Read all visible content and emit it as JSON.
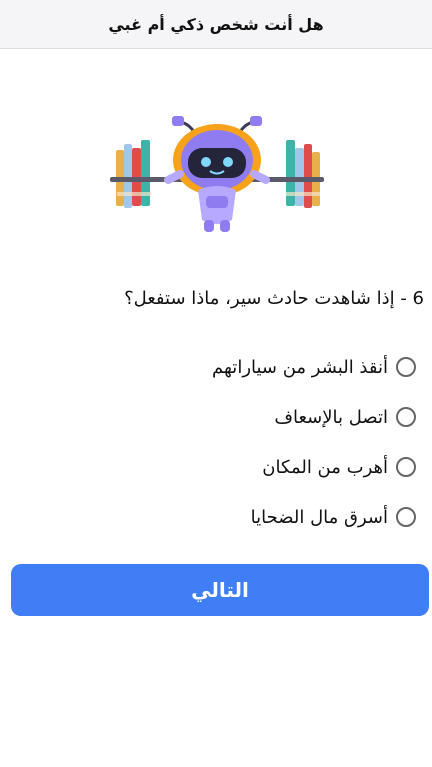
{
  "header": {
    "title": "هل أنت شخص ذكي أم غبي"
  },
  "illustration": {
    "name": "robot-lifting-books-icon"
  },
  "question": {
    "text": "6 - إذا شاهدت حادث سير، ماذا ستفعل؟"
  },
  "options": [
    {
      "label": "أنقذ البشر من سياراتهم",
      "selected": false
    },
    {
      "label": "اتصل بالإسعاف",
      "selected": false
    },
    {
      "label": "أهرب من المكان",
      "selected": false
    },
    {
      "label": "أسرق مال الضحايا",
      "selected": false
    }
  ],
  "next_button": {
    "label": "التالي"
  },
  "colors": {
    "accent": "#3f7ef5",
    "robot": "#8e7cf0",
    "helmet": "#f6a31b"
  }
}
